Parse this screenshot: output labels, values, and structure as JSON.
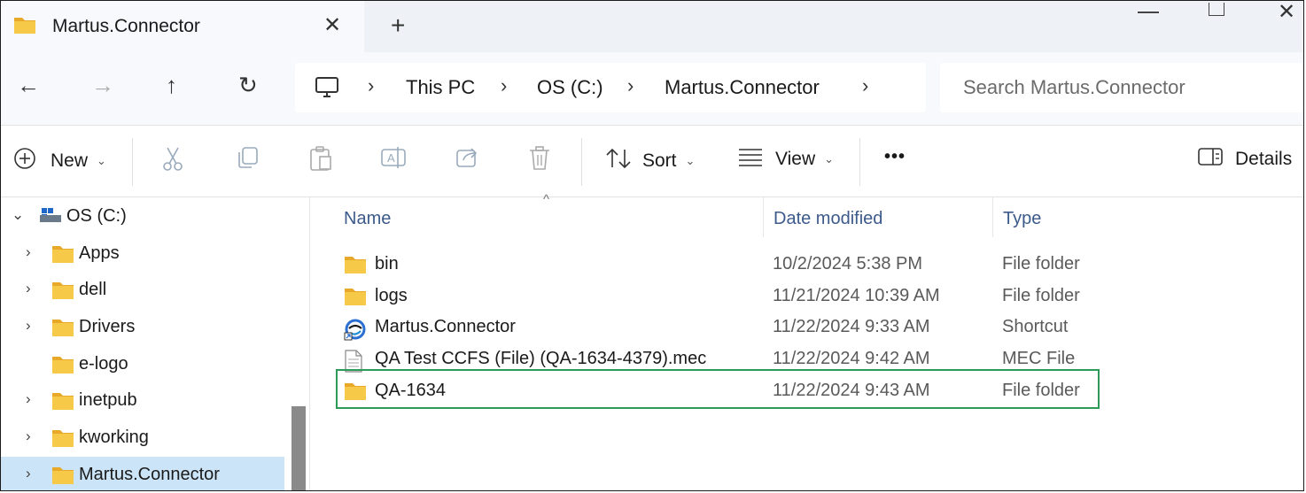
{
  "window": {
    "tab_title": "Martus.Connector",
    "close_glyph": "✕",
    "new_tab_glyph": "+",
    "close_window_glyph": "✕"
  },
  "nav": {
    "back_glyph": "←",
    "forward_glyph": "→",
    "up_glyph": "↑",
    "refresh_glyph": "↻",
    "breadcrumb": [
      "This PC",
      "OS (C:)",
      "Martus.Connector"
    ],
    "chevron": "›",
    "search_placeholder": "Search Martus.Connector"
  },
  "toolbar": {
    "new_label": "New",
    "sort_label": "Sort",
    "view_label": "View",
    "more_label": "•••",
    "details_label": "Details",
    "caret": "⌄"
  },
  "sidebar": {
    "root": {
      "label": "OS (C:)",
      "expander": "⌄"
    },
    "items": [
      {
        "label": "Apps",
        "expander": "›"
      },
      {
        "label": "dell",
        "expander": "›"
      },
      {
        "label": "Drivers",
        "expander": "›"
      },
      {
        "label": "e-logo",
        "expander": ""
      },
      {
        "label": "inetpub",
        "expander": "›"
      },
      {
        "label": "kworking",
        "expander": "›"
      },
      {
        "label": "Martus.Connector",
        "expander": "›"
      }
    ]
  },
  "columns": {
    "name": "Name",
    "date": "Date modified",
    "type": "Type",
    "sort_caret": "^"
  },
  "files": [
    {
      "name": "bin",
      "date": "10/2/2024 5:38 PM",
      "type": "File folder",
      "icon": "folder-icon"
    },
    {
      "name": "logs",
      "date": "11/21/2024 10:39 AM",
      "type": "File folder",
      "icon": "folder-icon"
    },
    {
      "name": "Martus.Connector",
      "date": "11/22/2024 9:33 AM",
      "type": "Shortcut",
      "icon": "shortcut-icon"
    },
    {
      "name": "QA Test CCFS (File) (QA-1634-4379).mec",
      "date": "11/22/2024 9:42 AM",
      "type": "MEC File",
      "icon": "file-icon"
    },
    {
      "name": "QA-1634",
      "date": "11/22/2024 9:43 AM",
      "type": "File folder",
      "icon": "folder-icon"
    }
  ],
  "colors": {
    "folder": "#f7c948",
    "folder_dark": "#e8a92a",
    "selected": "#cce4f7",
    "highlight_border": "#2e9a58"
  }
}
